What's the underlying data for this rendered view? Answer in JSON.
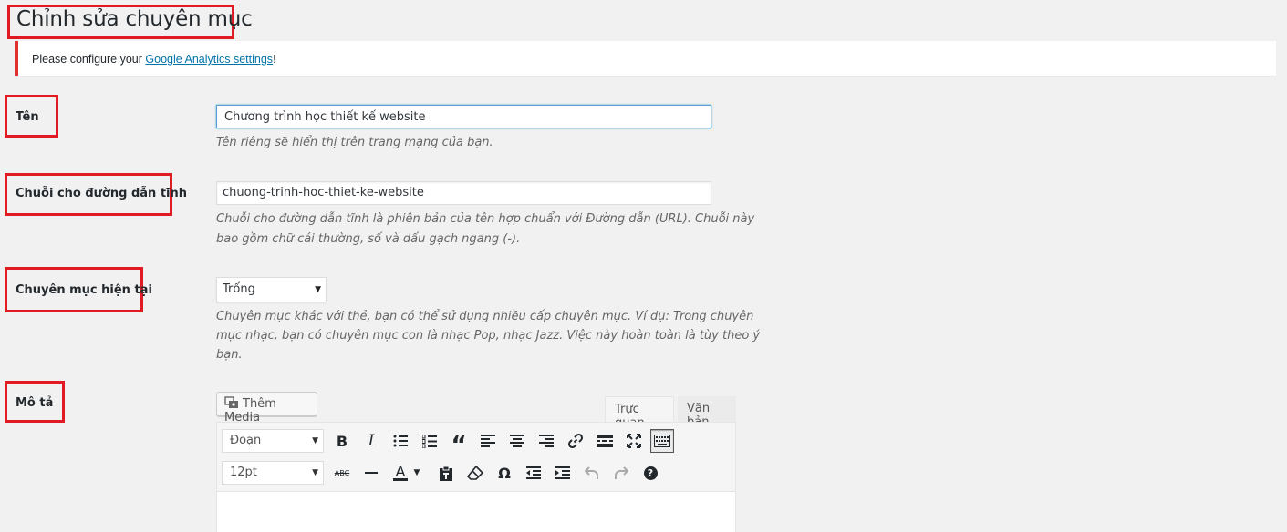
{
  "page": {
    "title": "Chỉnh sửa chuyên mục"
  },
  "notice": {
    "text_before": "Please configure your ",
    "link_text": "Google Analytics settings",
    "text_after": "!"
  },
  "fields": {
    "name": {
      "label": "Tên",
      "value": "Chương trình học thiết kế website",
      "description": "Tên riêng sẽ hiển thị trên trang mạng của bạn."
    },
    "slug": {
      "label": "Chuỗi cho đường dẫn tĩnh",
      "value": "chuong-trinh-hoc-thiet-ke-website",
      "description_line1": "Chuỗi cho đường dẫn tĩnh là phiên bản của tên hợp chuẩn với Đường dẫn (URL). Chuỗi này",
      "description_line2": "bao gồm chữ cái thường, số và dấu gạch ngang (-)."
    },
    "parent": {
      "label": "Chuyên mục hiện tại",
      "selected": "Trống",
      "description_line1": "Chuyên mục khác với thẻ, bạn có thể sử dụng nhiều cấp chuyên mục. Ví dụ: Trong chuyên",
      "description_line2": "mục nhạc, bạn có chuyên mục con là nhạc Pop, nhạc Jazz. Việc này hoàn toàn là tùy theo ý",
      "description_line3": "bạn."
    },
    "description": {
      "label": "Mô tả"
    }
  },
  "editor": {
    "add_media_label": "Thêm Media",
    "tabs": {
      "visual": "Trực quan",
      "text": "Văn bản"
    },
    "format_select": "Đoạn",
    "font_size_select": "12pt",
    "toolbar_row1_icons": [
      "bold-icon",
      "italic-icon",
      "bullet-list-icon",
      "numbered-list-icon",
      "blockquote-icon",
      "align-left-icon",
      "align-center-icon",
      "align-right-icon",
      "link-icon",
      "read-more-icon",
      "fullscreen-icon",
      "toolbar-toggle-icon"
    ],
    "toolbar_row2_icons": [
      "strikethrough-icon",
      "horizontal-line-icon",
      "text-color-icon",
      "paste-text-icon",
      "clear-formatting-icon",
      "special-character-icon",
      "outdent-icon",
      "indent-icon",
      "undo-icon",
      "redo-icon",
      "help-icon"
    ],
    "glyphs": {
      "bold": "B",
      "italic": "I",
      "abc": "ABC",
      "text_color": "A",
      "omega": "Ω",
      "help": "?",
      "quote": "“"
    },
    "colors": {
      "highlight_border": "#e01b24",
      "link": "#0073aa",
      "notice_border": "#dc3232"
    }
  }
}
